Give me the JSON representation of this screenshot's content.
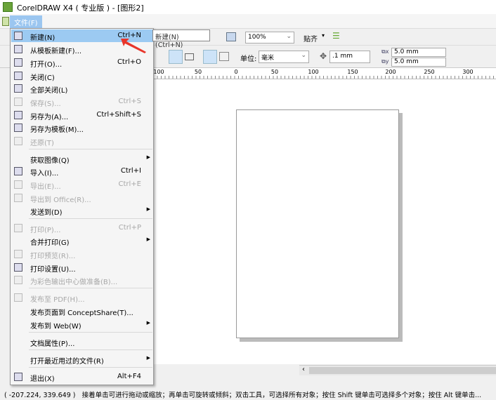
{
  "window": {
    "title": "CorelDRAW X4 ( 专业版 ) - [图形2]"
  },
  "menubar": {
    "file": "文件(F)"
  },
  "toolbar": {
    "zoom": "100%",
    "snap": "贴齐",
    "unit_label": "单位:",
    "unit": "毫米",
    "nudge": ".1 mm",
    "dup_x": "5.0 mm",
    "dup_y": "5.0 mm"
  },
  "tooltip": "新建(N) (Ctrl+N)",
  "ruler": {
    "labels": [
      "100",
      "50",
      "0",
      "50",
      "100",
      "150",
      "200",
      "250",
      "300"
    ]
  },
  "menu": {
    "items": [
      {
        "label": "新建(N)",
        "shortcut": "Ctrl+N",
        "state": "highlighted",
        "icon": "new-doc-icon"
      },
      {
        "label": "从模板新建(F)...",
        "shortcut": "",
        "icon": "template-icon"
      },
      {
        "label": "打开(O)...",
        "shortcut": "Ctrl+O",
        "icon": "folder-open-icon"
      },
      {
        "label": "关闭(C)",
        "shortcut": "",
        "icon": "close-doc-icon"
      },
      {
        "label": "全部关闭(L)",
        "shortcut": "",
        "icon": "close-all-icon"
      },
      {
        "label": "保存(S)...",
        "shortcut": "Ctrl+S",
        "state": "disabled",
        "icon": "save-icon"
      },
      {
        "label": "另存为(A)...",
        "shortcut": "Ctrl+Shift+S",
        "icon": "save-as-icon"
      },
      {
        "label": "另存为模板(M)...",
        "shortcut": "",
        "icon": "save-template-icon"
      },
      {
        "label": "还原(T)",
        "shortcut": "",
        "state": "disabled",
        "icon": "revert-icon"
      },
      {
        "label": "获取图像(Q)",
        "shortcut": "",
        "submenu": true
      },
      {
        "label": "导入(I)...",
        "shortcut": "Ctrl+I",
        "icon": "import-icon"
      },
      {
        "label": "导出(E)...",
        "shortcut": "Ctrl+E",
        "state": "disabled",
        "icon": "export-icon"
      },
      {
        "label": "导出到 Office(R)...",
        "shortcut": "",
        "state": "disabled",
        "icon": "export-office-icon"
      },
      {
        "label": "发送到(D)",
        "shortcut": "",
        "submenu": true
      },
      {
        "label": "打印(P)...",
        "shortcut": "Ctrl+P",
        "state": "disabled",
        "icon": "print-icon"
      },
      {
        "label": "合并打印(G)",
        "shortcut": "",
        "submenu": true
      },
      {
        "label": "打印预览(R)...",
        "shortcut": "",
        "state": "disabled",
        "icon": "print-preview-icon"
      },
      {
        "label": "打印设置(U)...",
        "shortcut": "",
        "icon": "print-setup-icon"
      },
      {
        "label": "为彩色输出中心做准备(B)...",
        "shortcut": "",
        "state": "disabled",
        "icon": "color-output-icon"
      },
      {
        "label": "发布至 PDF(H)...",
        "shortcut": "",
        "state": "disabled",
        "icon": "pdf-icon"
      },
      {
        "label": "发布页面到 ConceptShare(T)...",
        "shortcut": ""
      },
      {
        "label": "发布到 Web(W)",
        "shortcut": "",
        "submenu": true
      },
      {
        "label": "文档属性(P)...",
        "shortcut": ""
      },
      {
        "label": "打开最近用过的文件(R)",
        "shortcut": "",
        "submenu": true
      },
      {
        "label": "退出(X)",
        "shortcut": "Alt+F4",
        "icon": "exit-icon"
      }
    ]
  },
  "status": {
    "coords": "( -207.224, 339.649 )",
    "hint": "接着单击可进行拖动或缩放；再单击可旋转或倾斜；双击工具，可选择所有对象；按住 Shift 键单击可选择多个对象；按住 Alt 键单击..."
  },
  "colors": {
    "highlight": "#9ccaf2",
    "annotation_arrow": "#e8352a"
  }
}
